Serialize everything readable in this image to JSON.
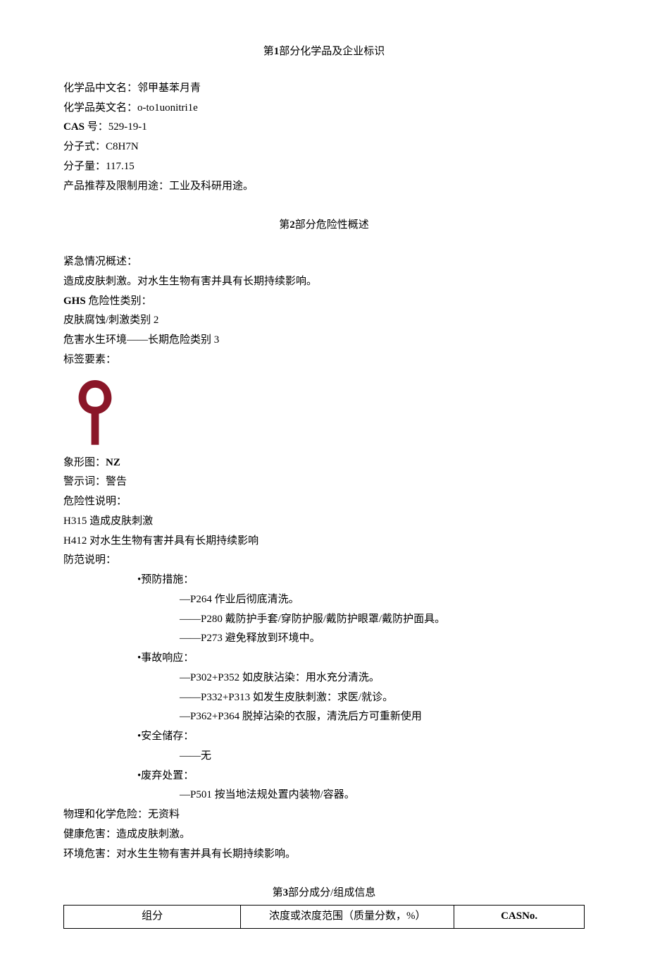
{
  "section1": {
    "title_prefix": "第",
    "title_num": "1",
    "title_suffix": "部分化学品及企业标识",
    "fields": {
      "cn_name_label": "化学品中文名：",
      "cn_name_value": "邻甲基苯月青",
      "en_name_label": "化学品英文名：",
      "en_name_value": "o-to1uonitri1e",
      "cas_label_bold": "CAS",
      "cas_label_rest": "号：",
      "cas_value": "529-19-1",
      "formula_label": "分子式：",
      "formula_value": "C8H7N",
      "mw_label": "分子量：",
      "mw_value": "117.15",
      "use_label": "产品推荐及限制用途：",
      "use_value": "工业及科研用途。"
    }
  },
  "section2": {
    "title_prefix": "第",
    "title_num": "2",
    "title_suffix": "部分危险性概述",
    "emergency_label": "紧急情况概述：",
    "emergency_text": "造成皮肤刺激。对水生生物有害并具有长期持续影响。",
    "ghs_label_bold": "GHS",
    "ghs_label_rest": "危险性类别：",
    "ghs_cat1": "皮肤腐蚀/刺激类别",
    "ghs_cat1_num": "2",
    "ghs_cat2": "危害水生环境——长期危险类别",
    "ghs_cat2_num": "3",
    "label_elements": "标签要素：",
    "pictogram_label": "象形图：",
    "pictogram_value": "NZ",
    "signal_label": "警示词：",
    "signal_value": "警告",
    "hazard_label": "危险性说明：",
    "h1_code": "H315",
    "h1_text": "造成皮肤刺激",
    "h2_code": "H412",
    "h2_text": "对水生生物有害并具有长期持续影响",
    "precaution_label": "防范说明：",
    "prevention_title": "•预防措施：",
    "prevention": [
      "—P264 作业后彻底清洗。",
      "——P280 戴防护手套/穿防护服/戴防护眼罩/戴防护面具。",
      "——P273 避免释放到环境中。"
    ],
    "response_title": "•事故响应：",
    "response": [
      "—P302+P352 如皮肤沾染：用水充分清洗。",
      "——P332+P313 如发生皮肤刺激：求医/就诊。",
      "—P362+P364 脱掉沾染的衣服，清洗后方可重新使用"
    ],
    "storage_title": "•安全储存：",
    "storage": [
      "——无"
    ],
    "disposal_title": "•废弃处置：",
    "disposal": [
      "—P501 按当地法规处置内装物/容器。"
    ],
    "phys_label": "物理和化学危险：",
    "phys_value": "无资料",
    "health_label": "健康危害：",
    "health_value": "造成皮肤刺激。",
    "env_label": "环境危害：",
    "env_value": "对水生生物有害并具有长期持续影响。"
  },
  "section3": {
    "title_prefix": "第",
    "title_num": "3",
    "title_suffix": "部分成分/组成信息",
    "headers": {
      "component": "组分",
      "conc_before": "浓度或浓度范围（质量分数，",
      "conc_pct": "%",
      "conc_after": "）",
      "cas": "CASNo."
    }
  }
}
